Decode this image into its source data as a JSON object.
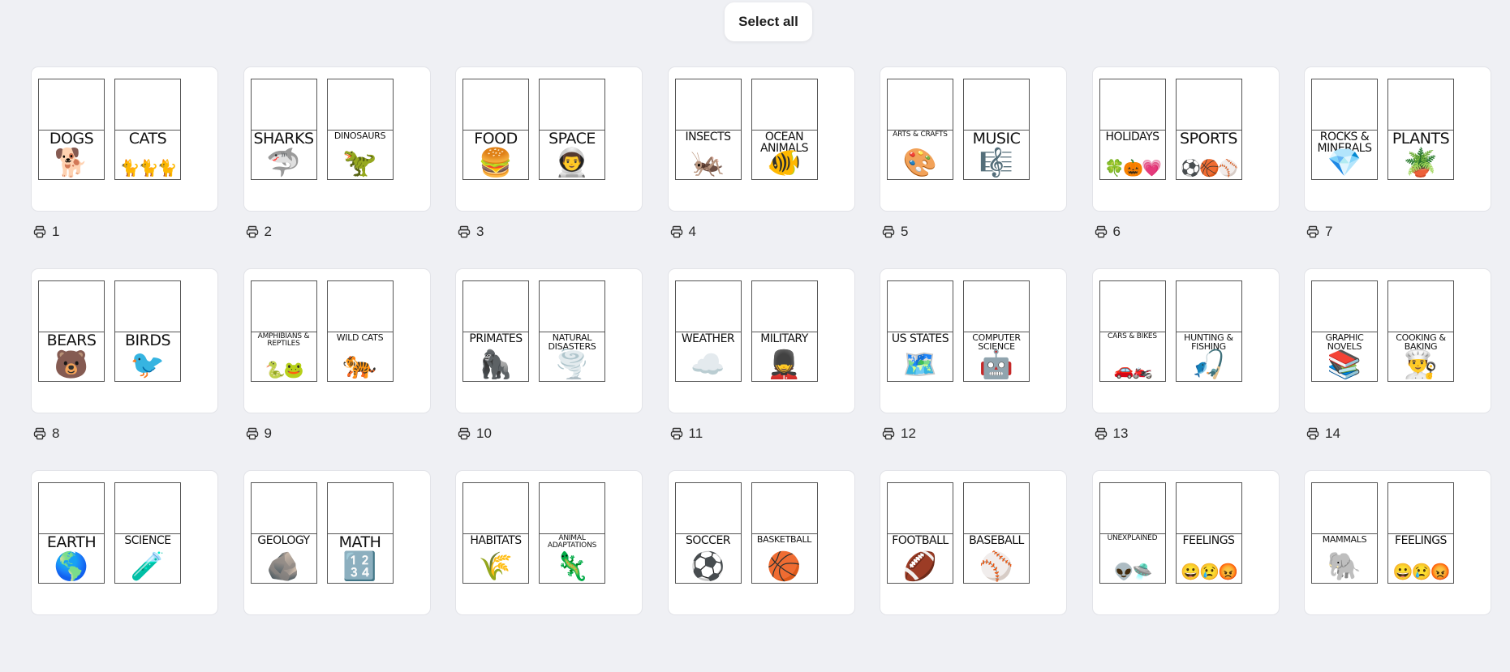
{
  "toolbar": {
    "select_all_label": "Select all"
  },
  "pages": [
    {
      "number": "1",
      "labels": [
        {
          "title": "DOGS",
          "size": "lg",
          "pic": "🐕"
        },
        {
          "title": "CATS",
          "size": "lg",
          "pic": "🐈🐈🐈",
          "wide": true
        }
      ]
    },
    {
      "number": "2",
      "labels": [
        {
          "title": "SHARKS",
          "size": "lg",
          "pic": "🦈"
        },
        {
          "title": "DINOSAURS",
          "size": "sm",
          "pic": "🦖"
        }
      ]
    },
    {
      "number": "3",
      "labels": [
        {
          "title": "FOOD",
          "size": "lg",
          "pic": "🍔"
        },
        {
          "title": "SPACE",
          "size": "lg",
          "pic": "👨‍🚀"
        }
      ]
    },
    {
      "number": "4",
      "labels": [
        {
          "title": "INSECTS",
          "size": "md",
          "pic": "🦗"
        },
        {
          "title": "OCEAN ANIMALS",
          "size": "md",
          "pic": "🐠"
        }
      ]
    },
    {
      "number": "5",
      "labels": [
        {
          "title": "ARTS & CRAFTS",
          "size": "xs",
          "pic": "🎨"
        },
        {
          "title": "MUSIC",
          "size": "lg",
          "pic": "🎼"
        }
      ]
    },
    {
      "number": "6",
      "labels": [
        {
          "title": "HOLIDAYS",
          "size": "md",
          "pic": "🍀🎃💗",
          "wide": true
        },
        {
          "title": "SPORTS",
          "size": "lg",
          "pic": "⚽🏀⚾",
          "wide": true
        }
      ]
    },
    {
      "number": "7",
      "labels": [
        {
          "title": "ROCKS & MINERALS",
          "size": "md",
          "pic": "💎"
        },
        {
          "title": "PLANTS",
          "size": "lg",
          "pic": "🪴"
        }
      ]
    },
    {
      "number": "8",
      "labels": [
        {
          "title": "BEARS",
          "size": "lg",
          "pic": "🐻"
        },
        {
          "title": "BIRDS",
          "size": "lg",
          "pic": "🐦"
        }
      ]
    },
    {
      "number": "9",
      "labels": [
        {
          "title": "AMPHIBIANS & REPTILES",
          "size": "xs",
          "pic": "🐍🐸",
          "wide": true
        },
        {
          "title": "WILD CATS",
          "size": "sm",
          "pic": "🐅"
        }
      ]
    },
    {
      "number": "10",
      "labels": [
        {
          "title": "PRIMATES",
          "size": "md",
          "pic": "🦍"
        },
        {
          "title": "NATURAL DISASTERS",
          "size": "sm",
          "pic": "🌪️"
        }
      ]
    },
    {
      "number": "11",
      "labels": [
        {
          "title": "WEATHER",
          "size": "md",
          "pic": "☁️"
        },
        {
          "title": "MILITARY",
          "size": "md",
          "pic": "💂"
        }
      ]
    },
    {
      "number": "12",
      "labels": [
        {
          "title": "US STATES",
          "size": "md",
          "pic": "🗺️"
        },
        {
          "title": "COMPUTER SCIENCE",
          "size": "sm",
          "pic": "🤖"
        }
      ]
    },
    {
      "number": "13",
      "labels": [
        {
          "title": "CARS & BIKES",
          "size": "xs",
          "pic": "🚗🏍️",
          "wide": true
        },
        {
          "title": "HUNTING & FISHING",
          "size": "sm",
          "pic": "🎣"
        }
      ]
    },
    {
      "number": "14",
      "labels": [
        {
          "title": "GRAPHIC NOVELS",
          "size": "sm",
          "pic": "📚"
        },
        {
          "title": "COOKING & BAKING",
          "size": "sm",
          "pic": "👨‍🍳"
        }
      ]
    },
    {
      "number": "",
      "labels": [
        {
          "title": "EARTH",
          "size": "lg",
          "pic": "🌎"
        },
        {
          "title": "SCIENCE",
          "size": "md",
          "pic": "🧪"
        }
      ]
    },
    {
      "number": "",
      "labels": [
        {
          "title": "GEOLOGY",
          "size": "md",
          "pic": "🪨"
        },
        {
          "title": "MATH",
          "size": "lg",
          "pic": "🔢"
        }
      ]
    },
    {
      "number": "",
      "labels": [
        {
          "title": "HABITATS",
          "size": "md",
          "pic": "🌾"
        },
        {
          "title": "ANIMAL ADAPTATIONS",
          "size": "xs",
          "pic": "🦎"
        }
      ]
    },
    {
      "number": "",
      "labels": [
        {
          "title": "SOCCER",
          "size": "md",
          "pic": "⚽"
        },
        {
          "title": "BASKETBALL",
          "size": "sm",
          "pic": "🏀"
        }
      ]
    },
    {
      "number": "",
      "labels": [
        {
          "title": "FOOTBALL",
          "size": "md",
          "pic": "🏈"
        },
        {
          "title": "BASEBALL",
          "size": "md",
          "pic": "⚾"
        }
      ]
    },
    {
      "number": "",
      "labels": [
        {
          "title": "UNEXPLAINED",
          "size": "xs",
          "pic": "👽🛸",
          "wide": true
        },
        {
          "title": "FEELINGS",
          "size": "md",
          "pic": "😀😢😡",
          "wide": true
        }
      ]
    },
    {
      "number": "",
      "labels": [
        {
          "title": "MAMMALS",
          "size": "sm",
          "pic": "🐘"
        },
        {
          "title": "FEELINGS",
          "size": "md",
          "pic": "😀😢😡",
          "wide": true
        }
      ]
    }
  ]
}
